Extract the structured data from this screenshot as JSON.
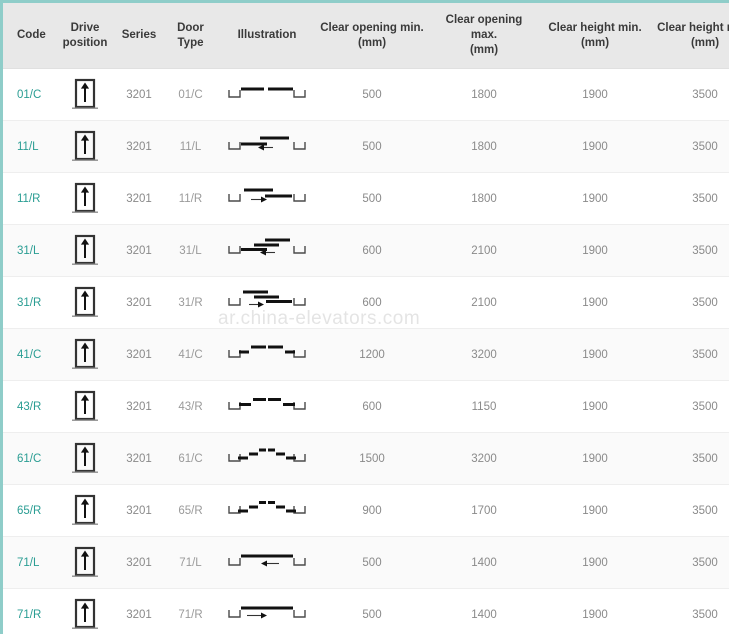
{
  "watermark": "ar.china-elevators.com",
  "colors": {
    "accent_border": "#8fcdc9",
    "link": "#2a9d93",
    "header_bg": "#e8e8e8",
    "row_alt_bg": "#fafafa",
    "text_muted": "#8a8a8a"
  },
  "table": {
    "headers": [
      {
        "label": "Code",
        "unit": ""
      },
      {
        "label": "Drive position",
        "unit": ""
      },
      {
        "label": "Series",
        "unit": ""
      },
      {
        "label": "Door Type",
        "unit": ""
      },
      {
        "label": "Illustration",
        "unit": ""
      },
      {
        "label": "Clear opening min.",
        "unit": "(mm)"
      },
      {
        "label": "Clear opening max.",
        "unit": "(mm)"
      },
      {
        "label": "Clear height min.",
        "unit": "(mm)"
      },
      {
        "label": "Clear height max.",
        "unit": "(mm)"
      }
    ],
    "rows": [
      {
        "code": "01/C",
        "drive_icon": "elevator-door-up-arrow-icon",
        "series": "3201",
        "door_type": "01/C",
        "illustration": "center-opening-2-panel-icon",
        "illus_kind": "center2",
        "clear_opening_min": "500",
        "clear_opening_max": "1800",
        "clear_height_min": "1900",
        "clear_height_max": "3500"
      },
      {
        "code": "11/L",
        "drive_icon": "elevator-door-up-arrow-icon",
        "series": "3201",
        "door_type": "11/L",
        "illustration": "side-opening-left-2-panel-icon",
        "illus_kind": "side2L",
        "clear_opening_min": "500",
        "clear_opening_max": "1800",
        "clear_height_min": "1900",
        "clear_height_max": "3500"
      },
      {
        "code": "11/R",
        "drive_icon": "elevator-door-up-arrow-icon",
        "series": "3201",
        "door_type": "11/R",
        "illustration": "side-opening-right-2-panel-icon",
        "illus_kind": "side2R",
        "clear_opening_min": "500",
        "clear_opening_max": "1800",
        "clear_height_min": "1900",
        "clear_height_max": "3500"
      },
      {
        "code": "31/L",
        "drive_icon": "elevator-door-up-arrow-icon",
        "series": "3201",
        "door_type": "31/L",
        "illustration": "side-opening-left-3-panel-icon",
        "illus_kind": "side3L",
        "clear_opening_min": "600",
        "clear_opening_max": "2100",
        "clear_height_min": "1900",
        "clear_height_max": "3500"
      },
      {
        "code": "31/R",
        "drive_icon": "elevator-door-up-arrow-icon",
        "series": "3201",
        "door_type": "31/R",
        "illustration": "side-opening-right-3-panel-icon",
        "illus_kind": "side3R",
        "clear_opening_min": "600",
        "clear_opening_max": "2100",
        "clear_height_min": "1900",
        "clear_height_max": "3500"
      },
      {
        "code": "41/C",
        "drive_icon": "elevator-door-up-arrow-icon",
        "series": "3201",
        "door_type": "41/C",
        "illustration": "center-opening-4-panel-icon",
        "illus_kind": "center4",
        "clear_opening_min": "1200",
        "clear_opening_max": "3200",
        "clear_height_min": "1900",
        "clear_height_max": "3500"
      },
      {
        "code": "43/R",
        "drive_icon": "elevator-door-up-arrow-icon",
        "series": "3201",
        "door_type": "43/R",
        "illustration": "center-opening-4-panel-right-icon",
        "illus_kind": "center4b",
        "clear_opening_min": "600",
        "clear_opening_max": "1150",
        "clear_height_min": "1900",
        "clear_height_max": "3500"
      },
      {
        "code": "61/C",
        "drive_icon": "elevator-door-up-arrow-icon",
        "series": "3201",
        "door_type": "61/C",
        "illustration": "center-opening-6-panel-icon",
        "illus_kind": "center6",
        "clear_opening_min": "1500",
        "clear_opening_max": "3200",
        "clear_height_min": "1900",
        "clear_height_max": "3500"
      },
      {
        "code": "65/R",
        "drive_icon": "elevator-door-up-arrow-icon",
        "series": "3201",
        "door_type": "65/R",
        "illustration": "center-opening-6-panel-right-icon",
        "illus_kind": "center6b",
        "clear_opening_min": "900",
        "clear_opening_max": "1700",
        "clear_height_min": "1900",
        "clear_height_max": "3500"
      },
      {
        "code": "71/L",
        "drive_icon": "elevator-door-up-arrow-icon",
        "series": "3201",
        "door_type": "71/L",
        "illustration": "single-slide-left-icon",
        "illus_kind": "single1L",
        "clear_opening_min": "500",
        "clear_opening_max": "1400",
        "clear_height_min": "1900",
        "clear_height_max": "3500"
      },
      {
        "code": "71/R",
        "drive_icon": "elevator-door-up-arrow-icon",
        "series": "3201",
        "door_type": "71/R",
        "illustration": "single-slide-right-icon",
        "illus_kind": "single1R",
        "clear_opening_min": "500",
        "clear_opening_max": "1400",
        "clear_height_min": "1900",
        "clear_height_max": "3500"
      }
    ]
  }
}
